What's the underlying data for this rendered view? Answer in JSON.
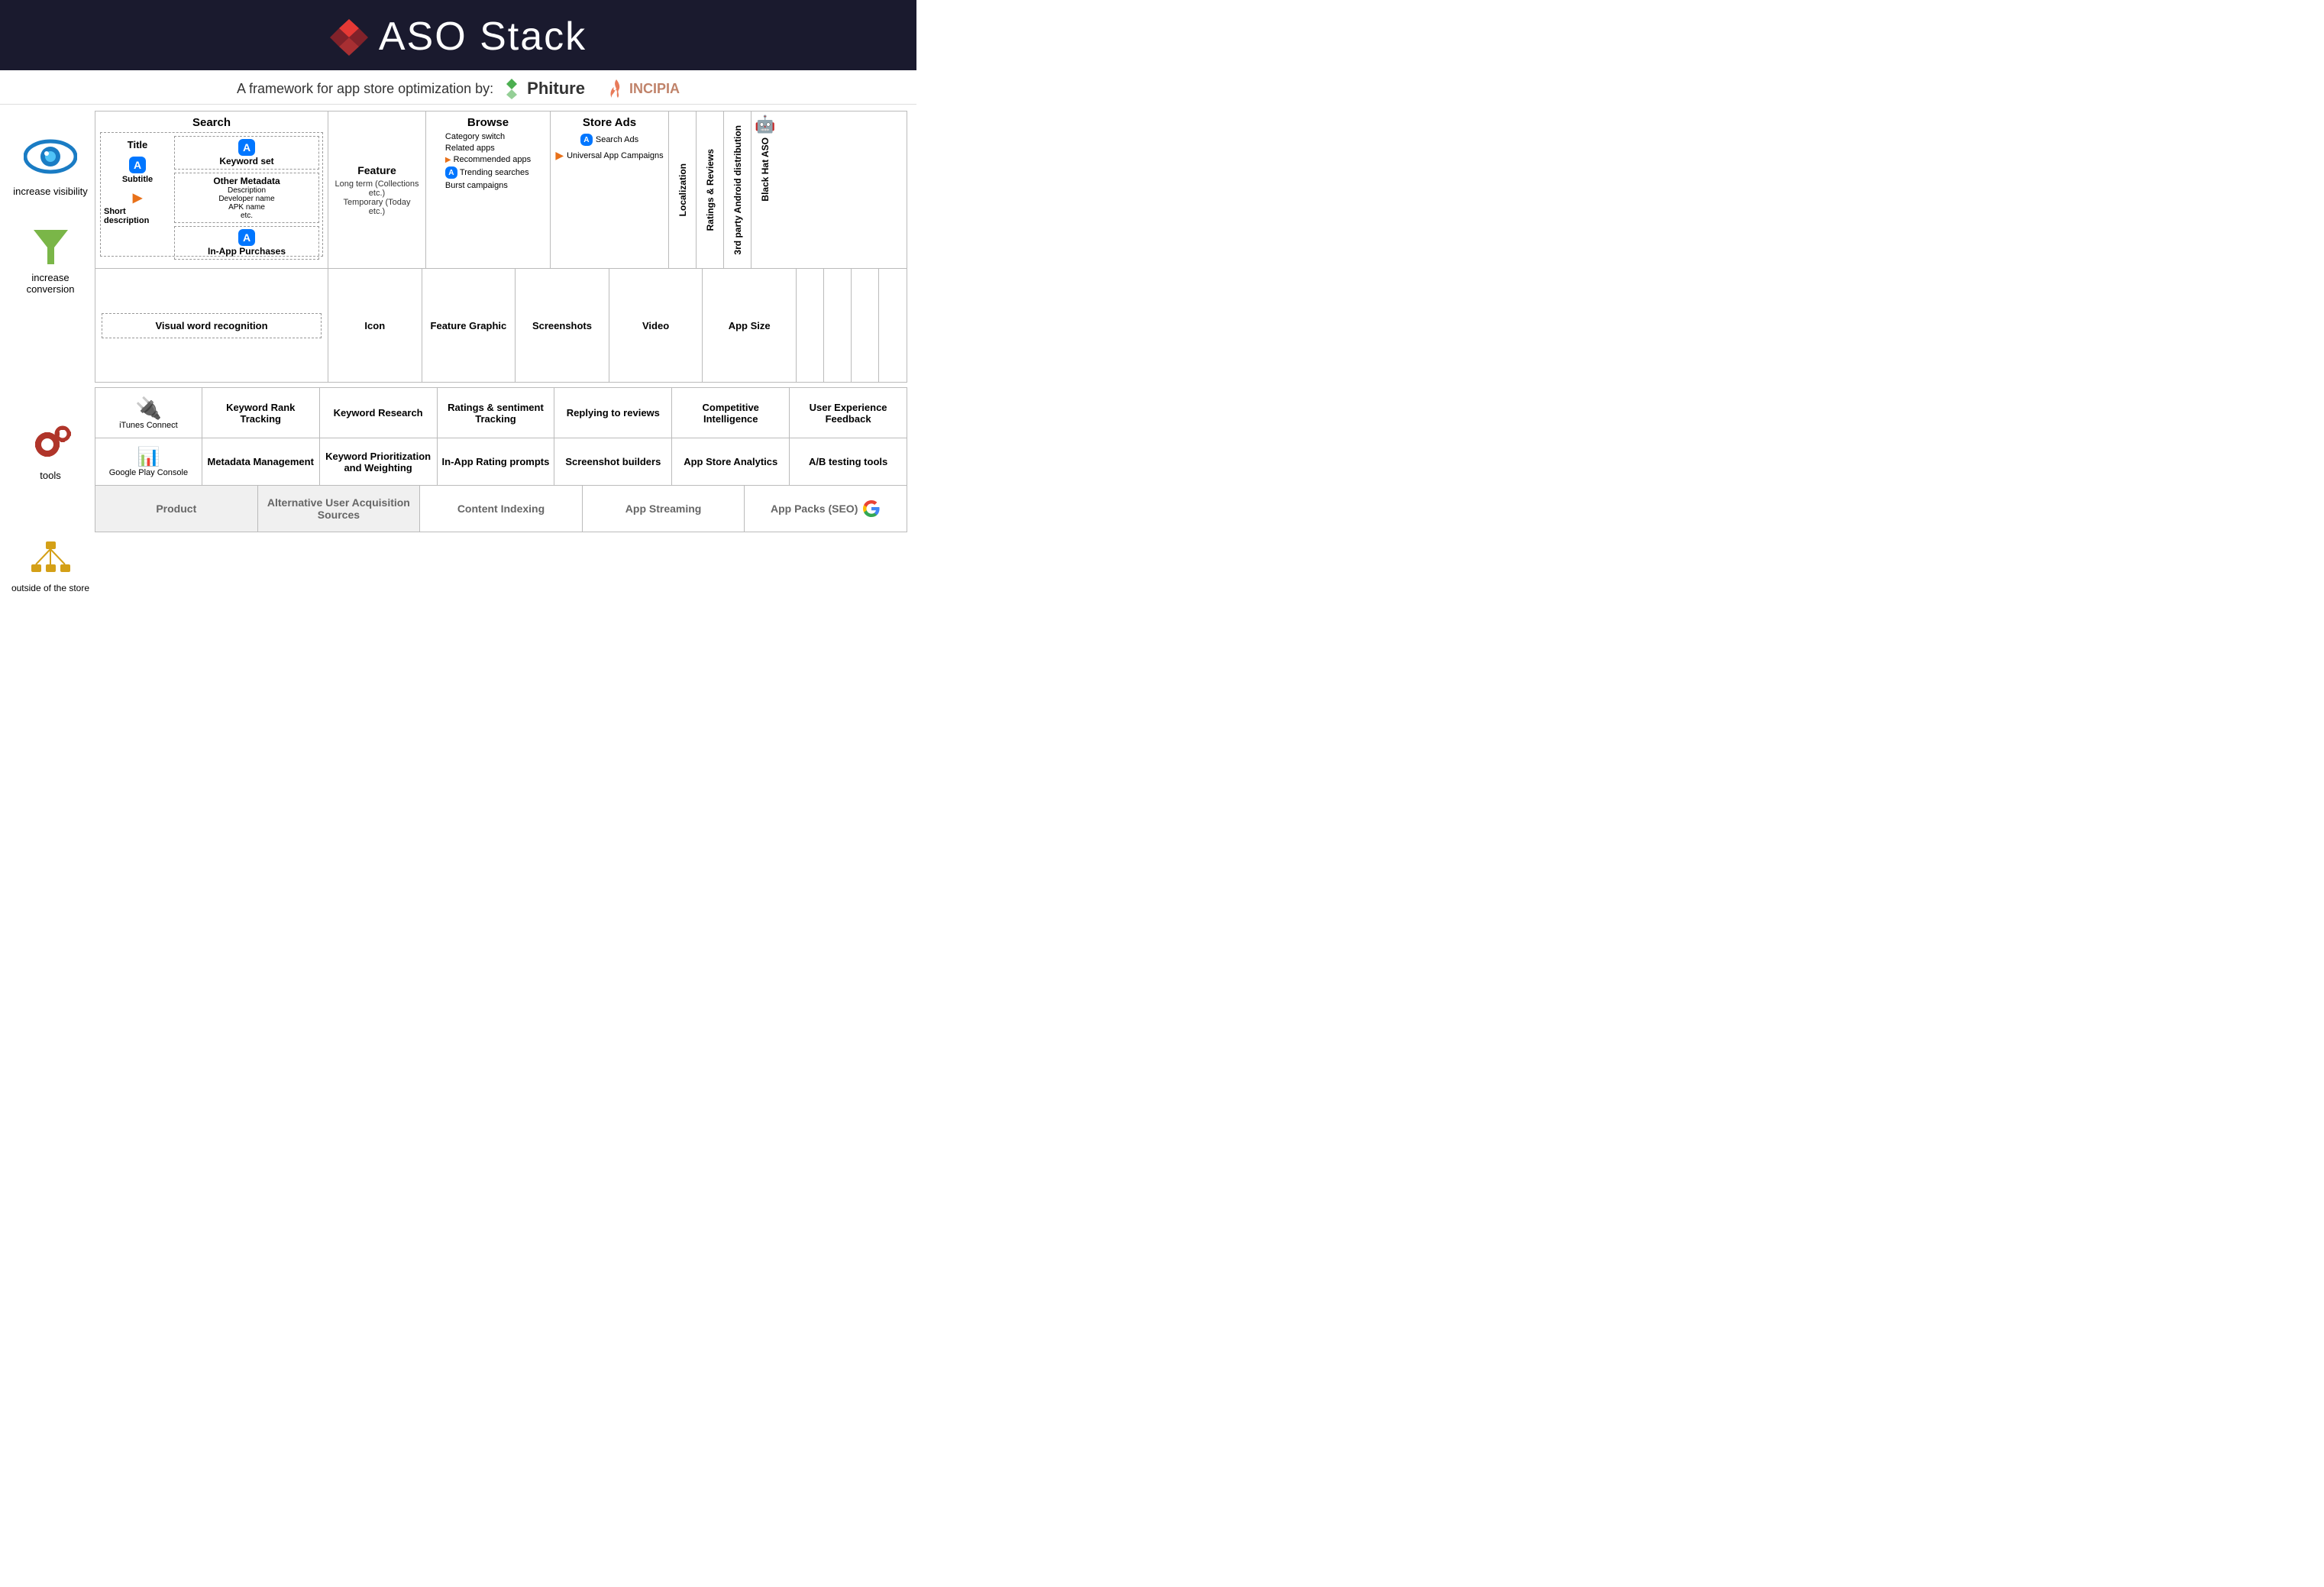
{
  "header": {
    "title": "ASO Stack",
    "subtitle": "A framework for app store optimization by:",
    "phiture": "Phiture",
    "incipia": "INCIPIA"
  },
  "left_labels": {
    "increase_visibility": "increase visibility",
    "increase_conversion": "increase conversion",
    "tools": "tools",
    "outside_store": "outside of the store"
  },
  "search": {
    "title": "Search",
    "title_label": "Title",
    "subtitle_label": "Subtitle",
    "short_desc_label": "Short description",
    "keyword_set_label": "Keyword set",
    "other_metadata_label": "Other Metadata",
    "other_metadata_items": "Description\nDeveloper name\nAPK name\netc.",
    "in_app_purchases_label": "In-App Purchases",
    "visual_word_label": "Visual word recognition"
  },
  "feature": {
    "title": "Feature",
    "subtitle": "Long term (Collections etc.)\nTemporary (Today etc.)"
  },
  "browse": {
    "title": "Browse",
    "items": [
      "Category switch",
      "Related apps",
      "Recommended apps",
      "Trending searches",
      "Burst campaigns"
    ]
  },
  "store_ads": {
    "title": "Store Ads",
    "search_ads": "Search Ads",
    "universal_app": "Universal App Campaigns"
  },
  "vertical_cols": {
    "localization": "Localization",
    "ratings_reviews": "Ratings & Reviews",
    "third_party": "3rd party Android distribution",
    "black_hat": "Black Hat ASO"
  },
  "bottom_vis_row": {
    "icon": "Icon",
    "feature_graphic": "Feature Graphic",
    "screenshots": "Screenshots",
    "video": "Video",
    "app_size": "App Size"
  },
  "tools_row1": {
    "itunes": "iTunes Connect",
    "keyword_rank": "Keyword Rank Tracking",
    "keyword_research": "Keyword Research",
    "ratings_sentiment": "Ratings & sentiment Tracking",
    "replying_reviews": "Replying to reviews",
    "competitive_intel": "Competitive Intelligence",
    "user_exp_feedback": "User Experience Feedback"
  },
  "tools_row2": {
    "google_play": "Google Play Console",
    "metadata_mgmt": "Metadata Management",
    "keyword_prior": "Keyword Prioritization and Weighting",
    "inapp_rating": "In-App Rating prompts",
    "screenshot_builders": "Screenshot builders",
    "app_store_analytics": "App Store Analytics",
    "ab_testing": "A/B testing tools"
  },
  "outside_row": {
    "product": "Product",
    "alt_user": "Alternative User Acquisition Sources",
    "content_indexing": "Content Indexing",
    "app_streaming": "App Streaming",
    "app_packs": "App Packs (SEO)"
  }
}
